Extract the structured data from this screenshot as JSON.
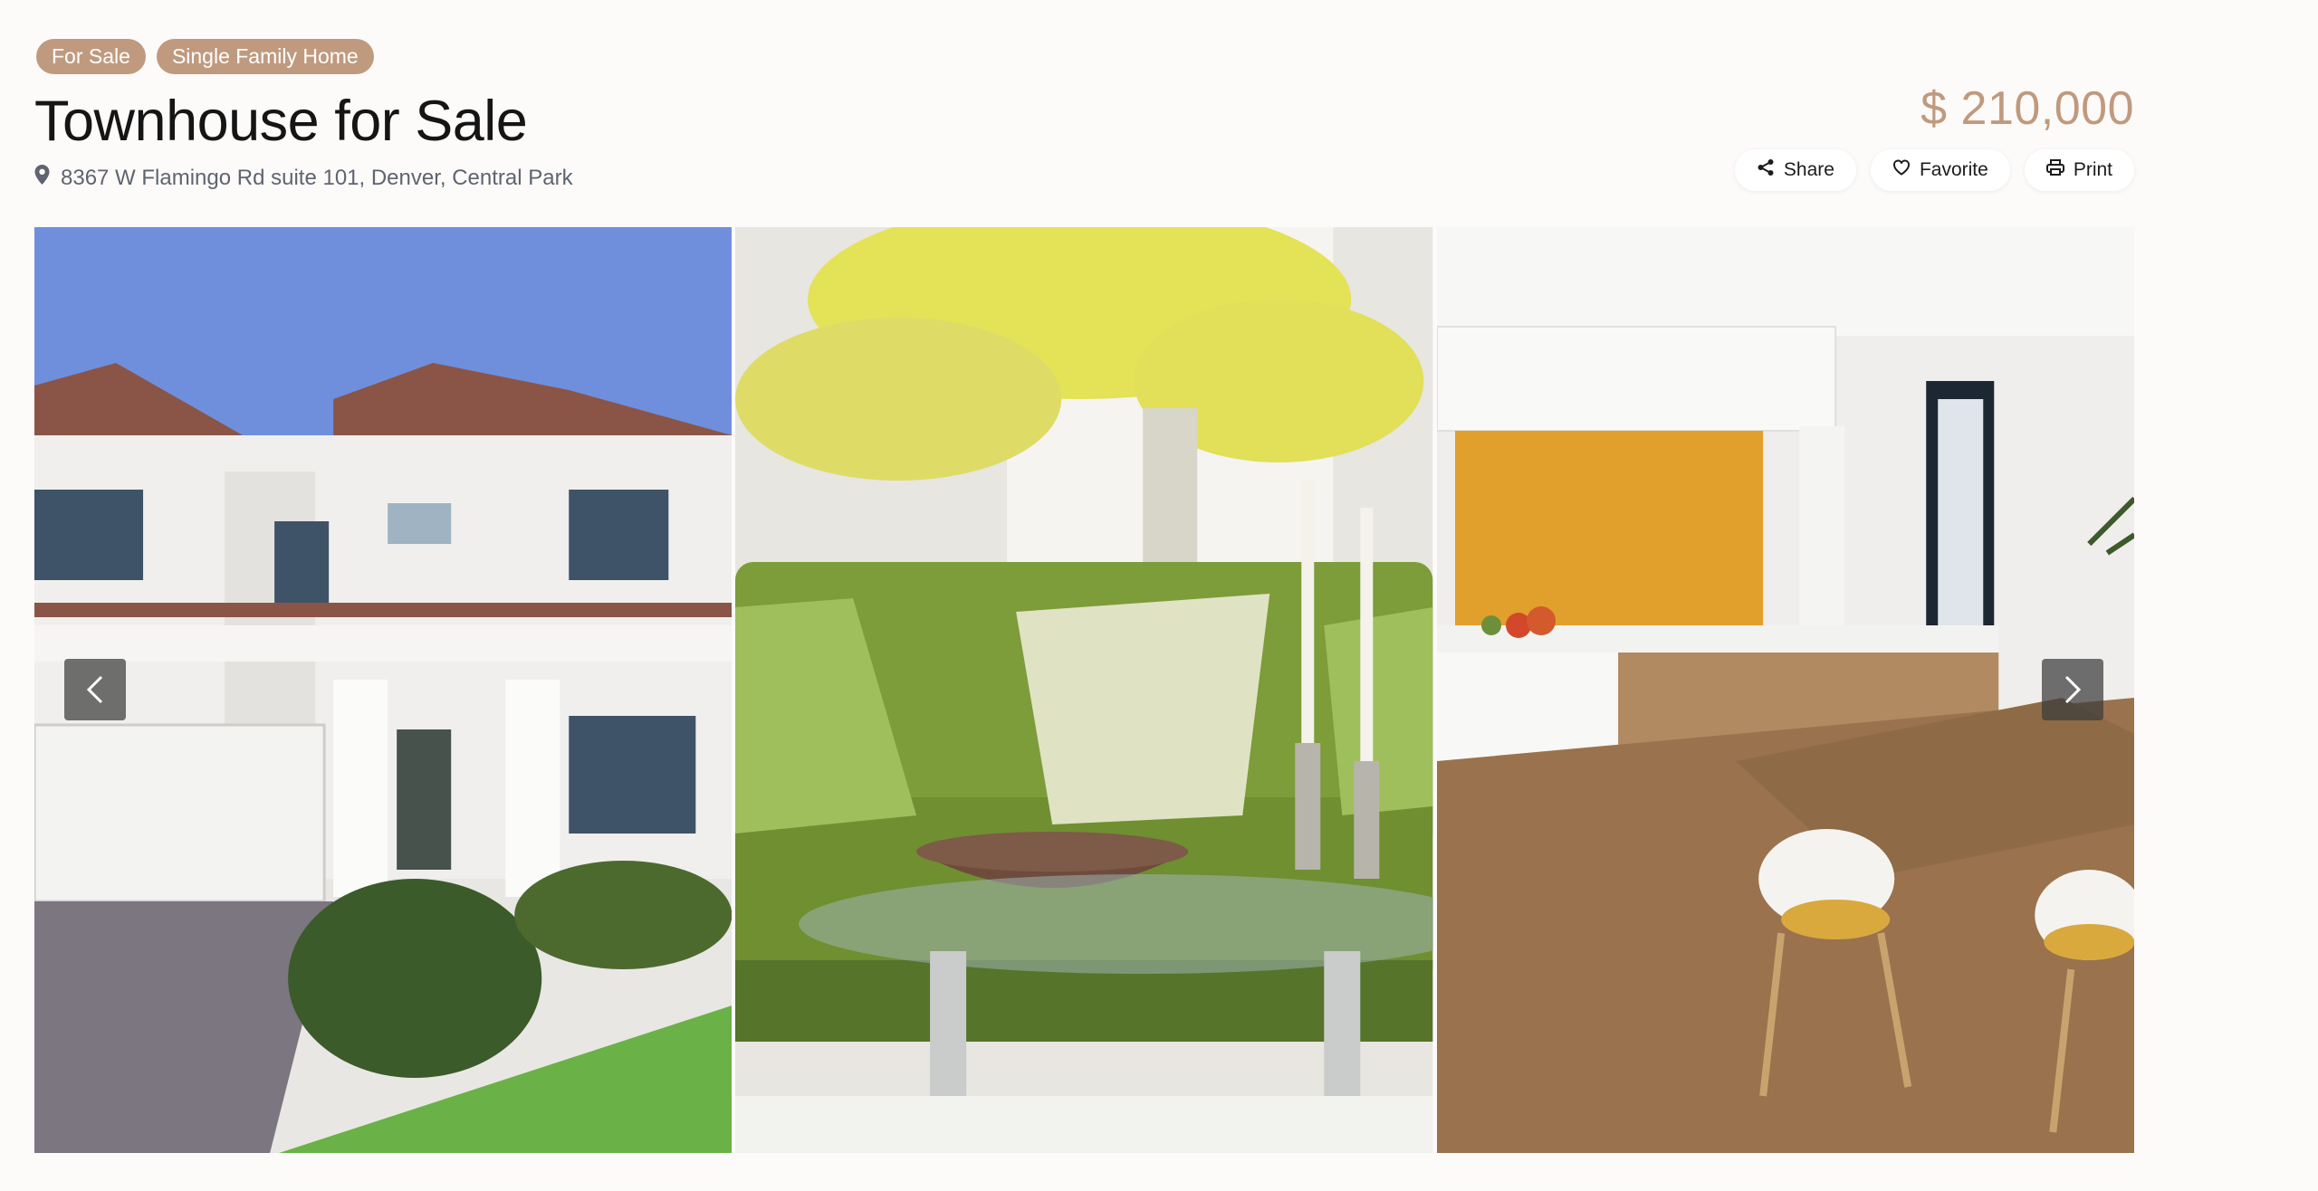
{
  "badges": [
    "For Sale",
    "Single Family Home"
  ],
  "listing": {
    "title": "Townhouse for Sale",
    "address": "8367 W Flamingo Rd suite 101, Denver, Central Park",
    "price": "$ 210,000"
  },
  "actions": {
    "share": "Share",
    "favorite": "Favorite",
    "print": "Print"
  },
  "gallery": {
    "slides": [
      "house-exterior-photo",
      "living-room-photo",
      "kitchen-photo"
    ]
  },
  "colors": {
    "accent": "#c09a7e",
    "background": "#fdfbfa",
    "text": "#151515",
    "muted": "#5e6470"
  },
  "icons": {
    "address": "map-pin-icon",
    "share": "share-icon",
    "favorite": "heart-icon",
    "print": "printer-icon",
    "prev": "chevron-left-icon",
    "next": "chevron-right-icon"
  }
}
